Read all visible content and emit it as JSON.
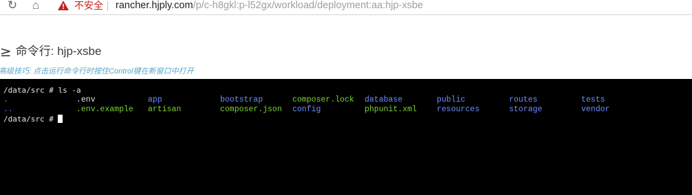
{
  "browser": {
    "reload_icon": "reload-icon",
    "home_icon": "home-icon",
    "warning_icon": "warning-triangle-icon",
    "security_label": "不安全",
    "url_host": "rancher.hjply.com",
    "url_path": "/p/c-h8gkl:p-l52gx/workload/deployment:aa:hjp-xsbe"
  },
  "page": {
    "title_icon": "≥",
    "title": "命令行: hjp-xsbe",
    "hint": "高级技巧: 点击运行命令行时按住Control键在新窗口中打开"
  },
  "terminal": {
    "command_line": "/data/src # ls -a",
    "prompt_line": "/data/src # ",
    "listing_row1": [
      {
        "name": ".",
        "kind": "dir"
      },
      {
        "name": ".env",
        "kind": "file"
      },
      {
        "name": "app",
        "kind": "dir"
      },
      {
        "name": "bootstrap",
        "kind": "dir"
      },
      {
        "name": "composer.lock",
        "kind": "exe"
      },
      {
        "name": "database",
        "kind": "dir"
      },
      {
        "name": "public",
        "kind": "dir"
      },
      {
        "name": "routes",
        "kind": "dir"
      },
      {
        "name": "tests",
        "kind": "dir"
      }
    ],
    "listing_row2": [
      {
        "name": "..",
        "kind": "dir"
      },
      {
        "name": ".env.example",
        "kind": "exe"
      },
      {
        "name": "artisan",
        "kind": "exe"
      },
      {
        "name": "composer.json",
        "kind": "exe"
      },
      {
        "name": "config",
        "kind": "dir"
      },
      {
        "name": "phpunit.xml",
        "kind": "exe"
      },
      {
        "name": "resources",
        "kind": "dir"
      },
      {
        "name": "storage",
        "kind": "dir"
      },
      {
        "name": "vendor",
        "kind": "dir"
      }
    ],
    "colors": {
      "dir": "#6c8dff",
      "exe": "#7cd331",
      "file": "#e6e6e6",
      "background": "#000000"
    }
  }
}
